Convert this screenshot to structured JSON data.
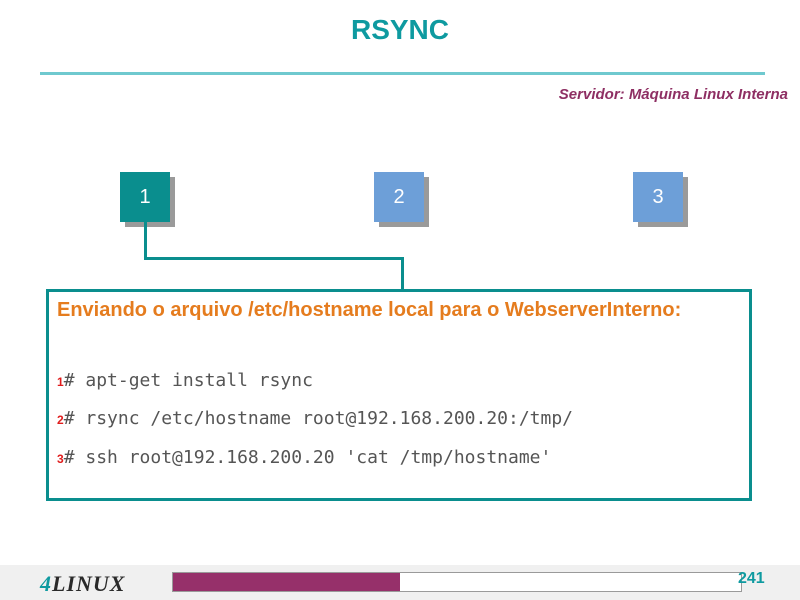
{
  "header": {
    "title": "RSYNC",
    "subtitle": "Servidor: Máquina Linux Interna"
  },
  "steps": [
    {
      "label": "1",
      "active": true
    },
    {
      "label": "2",
      "active": false
    },
    {
      "label": "3",
      "active": false
    }
  ],
  "content": {
    "heading": "Enviando o arquivo /etc/hostname local para o WebserverInterno:",
    "commands": [
      {
        "num": "1",
        "text": "# apt-get install rsync"
      },
      {
        "num": "2",
        "text": "# rsync /etc/hostname root@192.168.200.20:/tmp/"
      },
      {
        "num": "3",
        "text": "# ssh root@192.168.200.20 'cat /tmp/hostname'"
      }
    ]
  },
  "footer": {
    "logo_number": "4",
    "logo_text": "LINUX",
    "page_number": "241",
    "progress": 0.4
  },
  "colors": {
    "accent": "#0e9aa0",
    "step_active": "#0a8e8e",
    "step_inactive": "#6d9fd8",
    "subtitle": "#8e2f63",
    "heading": "#e57c1e",
    "progress": "#96306a"
  }
}
